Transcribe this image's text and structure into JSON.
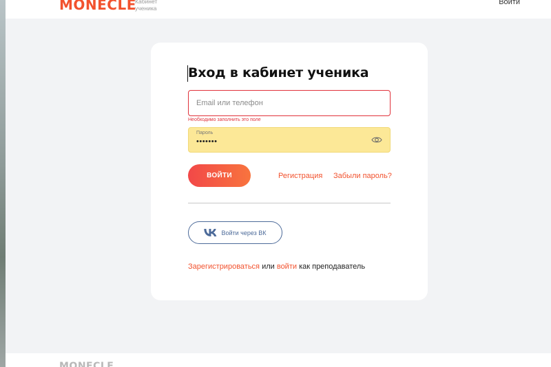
{
  "header": {
    "logo": "MONECLE",
    "logo_sub": "Кабинет ученика",
    "login_link": "Войти"
  },
  "form": {
    "title": "Вход в кабинет ученика",
    "email_placeholder": "Email или телефон",
    "email_value": "",
    "email_error": "Необходимо заполнить это поле",
    "password_label": "Пароль",
    "password_value": "•••••••",
    "submit_label": "ВОЙТИ",
    "register_link": "Регистрация",
    "forgot_link": "Забыли пароль?",
    "vk_button": "Войти через ВК",
    "teacher": {
      "register": "Зарегистрироваться",
      "or": " или ",
      "login": "войти",
      "as_teacher": " как преподаватель"
    }
  },
  "footer": {
    "logo": "MONECLE"
  },
  "icons": {
    "password_toggle": "eye-icon",
    "vk": "vk-icon"
  },
  "colors": {
    "accent": "#f2522e",
    "error": "#e0313a",
    "autofill": "#fce897",
    "vk": "#4c6a99"
  }
}
